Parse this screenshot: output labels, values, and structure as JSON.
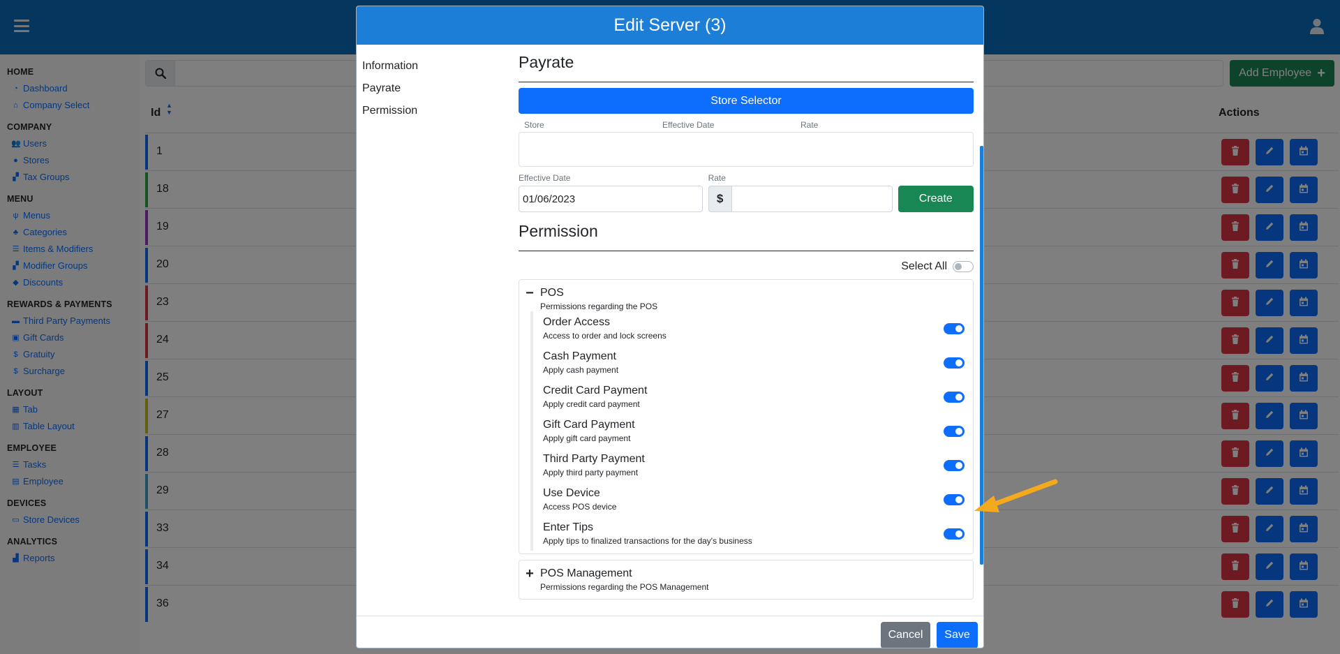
{
  "sidebar": {
    "sections": [
      {
        "title": "HOME",
        "items": [
          {
            "label": "Dashboard",
            "icon": "gauge-icon"
          },
          {
            "label": "Company Select",
            "icon": "home-icon"
          }
        ]
      },
      {
        "title": "COMPANY",
        "items": [
          {
            "label": "Users",
            "icon": "users-icon"
          },
          {
            "label": "Stores",
            "icon": "map-pin-icon"
          },
          {
            "label": "Tax Groups",
            "icon": "sitemap-icon"
          }
        ]
      },
      {
        "title": "MENU",
        "items": [
          {
            "label": "Menus",
            "icon": "utensils-icon"
          },
          {
            "label": "Categories",
            "icon": "shapes-icon"
          },
          {
            "label": "Items & Modifiers",
            "icon": "list-icon"
          },
          {
            "label": "Modifier Groups",
            "icon": "sitemap-icon"
          },
          {
            "label": "Discounts",
            "icon": "tags-icon"
          }
        ]
      },
      {
        "title": "REWARDS & PAYMENTS",
        "items": [
          {
            "label": "Third Party Payments",
            "icon": "money-icon"
          },
          {
            "label": "Gift Cards",
            "icon": "gift-card-icon"
          },
          {
            "label": "Gratuity",
            "icon": "dollar-icon"
          },
          {
            "label": "Surcharge",
            "icon": "dollar-icon"
          }
        ]
      },
      {
        "title": "LAYOUT",
        "items": [
          {
            "label": "Tab",
            "icon": "table-icon"
          },
          {
            "label": "Table Layout",
            "icon": "map-icon"
          }
        ]
      },
      {
        "title": "EMPLOYEE",
        "items": [
          {
            "label": "Tasks",
            "icon": "list-icon"
          },
          {
            "label": "Employee",
            "icon": "id-card-icon"
          }
        ]
      },
      {
        "title": "DEVICES",
        "items": [
          {
            "label": "Store Devices",
            "icon": "laptop-icon"
          }
        ]
      },
      {
        "title": "ANALYTICS",
        "items": [
          {
            "label": "Reports",
            "icon": "chart-icon"
          }
        ]
      }
    ]
  },
  "main": {
    "add_button": "Add Employee",
    "col_id": "Id",
    "col_actions": "Actions",
    "rows": [
      {
        "id": "1",
        "color": "#0d6efd"
      },
      {
        "id": "18",
        "color": "#28a745"
      },
      {
        "id": "19",
        "color": "#9b30c9"
      },
      {
        "id": "20",
        "color": "#0d6efd"
      },
      {
        "id": "23",
        "color": "#dc3545"
      },
      {
        "id": "24",
        "color": "#dc3545"
      },
      {
        "id": "25",
        "color": "#0d6efd"
      },
      {
        "id": "27",
        "color": "#c7c21a"
      },
      {
        "id": "28",
        "color": "#0d6efd"
      },
      {
        "id": "29",
        "color": "#3aa0c9"
      },
      {
        "id": "33",
        "color": "#0d6efd"
      },
      {
        "id": "34",
        "color": "#0d6efd"
      },
      {
        "id": "36",
        "color": "#0d6efd"
      }
    ]
  },
  "modal": {
    "title": "Edit Server (3)",
    "nav": [
      "Information",
      "Payrate",
      "Permission"
    ],
    "payrate": {
      "title": "Payrate",
      "store_selector": "Store Selector",
      "columns": [
        "Store",
        "Effective Date",
        "Rate"
      ],
      "effective_date_label": "Effective Date",
      "effective_date_value": "01/06/2023",
      "rate_label": "Rate",
      "currency_symbol": "$",
      "rate_value": "",
      "create_button": "Create"
    },
    "permission": {
      "title": "Permission",
      "select_all_label": "Select All",
      "groups": [
        {
          "title": "POS",
          "desc": "Permissions regarding the POS",
          "expanded": true,
          "items": [
            {
              "name": "Order Access",
              "desc": "Access to order and lock screens",
              "enabled": true
            },
            {
              "name": "Cash Payment",
              "desc": "Apply cash payment",
              "enabled": true
            },
            {
              "name": "Credit Card Payment",
              "desc": "Apply credit card payment",
              "enabled": true
            },
            {
              "name": "Gift Card Payment",
              "desc": "Apply gift card payment",
              "enabled": true
            },
            {
              "name": "Third Party Payment",
              "desc": "Apply third party payment",
              "enabled": true
            },
            {
              "name": "Use Device",
              "desc": "Access POS device",
              "enabled": true
            },
            {
              "name": "Enter Tips",
              "desc": "Apply tips to finalized transactions for the day's business",
              "enabled": true
            }
          ]
        },
        {
          "title": "POS Management",
          "desc": "Permissions regarding the POS Management",
          "expanded": false,
          "items": []
        }
      ]
    },
    "cancel_button": "Cancel",
    "save_button": "Save"
  },
  "colors": {
    "header_blue": "#0a6ebd",
    "primary": "#0d6efd",
    "success": "#198754",
    "danger": "#dc3545",
    "annotation_arrow": "#f5a91c"
  }
}
